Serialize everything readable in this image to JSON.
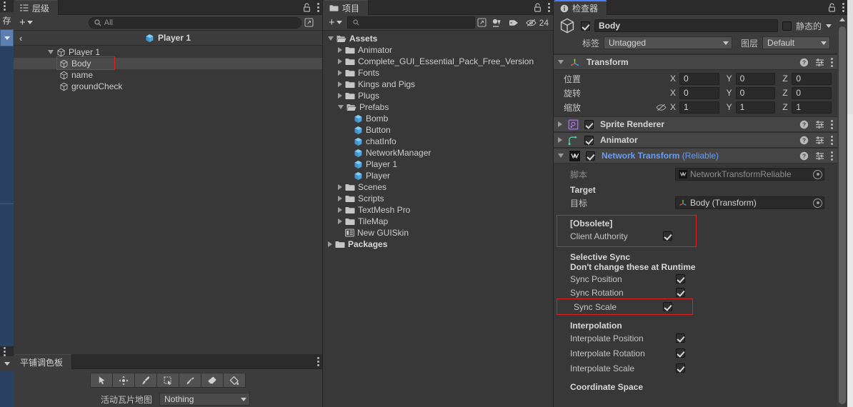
{
  "left_strip": {
    "label": "存",
    "kebab_icon": "kebab-icon",
    "dropdown_icon": "caret-down-icon"
  },
  "hierarchy": {
    "tab_label": "层级",
    "tab_icon": "hierarchy-icon",
    "lock_icon": "lock-icon",
    "menu_icon": "kebab-icon",
    "add_label": "+",
    "add_caret_icon": "caret-down-icon",
    "search": {
      "placeholder": "All",
      "value": "",
      "icon": "search-icon"
    },
    "expand_icon": "open-in-new-icon",
    "breadcrumb": {
      "back_icon": "back-arrow-icon",
      "title": "Player 1",
      "icon": "prefab-icon"
    },
    "tree": [
      {
        "label": "Player 1",
        "depth": 0,
        "expanded": true,
        "icon": "gameobject-icon",
        "selected": false,
        "highlighted": false
      },
      {
        "label": "Body",
        "depth": 1,
        "expanded": null,
        "icon": "gameobject-icon",
        "selected": true,
        "highlighted": true
      },
      {
        "label": "name",
        "depth": 1,
        "expanded": null,
        "icon": "gameobject-icon",
        "selected": false,
        "highlighted": false
      },
      {
        "label": "groundCheck",
        "depth": 1,
        "expanded": null,
        "icon": "gameobject-icon",
        "selected": false,
        "highlighted": false
      }
    ]
  },
  "tile_palette": {
    "tab_label": "平铺调色板",
    "tab_icon": "tilepalette-icon",
    "menu_icon": "kebab-icon",
    "tools": [
      {
        "name": "select-tool",
        "icon": "cursor-arrow-icon"
      },
      {
        "name": "move-tool",
        "icon": "move-icon"
      },
      {
        "name": "paint-tool",
        "icon": "brush-icon"
      },
      {
        "name": "box-fill-tool",
        "icon": "marquee-icon"
      },
      {
        "name": "picker-tool",
        "icon": "eyedropper-icon"
      },
      {
        "name": "erase-tool",
        "icon": "eraser-icon"
      },
      {
        "name": "fill-tool",
        "icon": "paint-bucket-icon"
      }
    ],
    "active_tilemap_label": "活动瓦片地图",
    "active_tilemap_value": "Nothing",
    "dropdown_icon": "caret-down-icon"
  },
  "project": {
    "tab_label": "项目",
    "tab_icon": "folder-icon",
    "lock_icon": "lock-icon",
    "menu_icon": "kebab-icon",
    "add_label": "+",
    "add_caret_icon": "caret-down-icon",
    "search": {
      "placeholder": "",
      "value": "",
      "icon": "search-icon"
    },
    "expand_icon": "open-in-new-icon",
    "filter_type_icon": "filter-by-type-icon",
    "filter_label_icon": "filter-by-label-icon",
    "hidden_count": "24",
    "hidden_icon": "eye-off-icon",
    "tree": [
      {
        "label": "Assets",
        "depth": 0,
        "expanded": true,
        "icon": "folder-open-icon",
        "bold": true
      },
      {
        "label": "Animator",
        "depth": 1,
        "expanded": false,
        "icon": "folder-icon",
        "bold": false
      },
      {
        "label": "Complete_GUI_Essential_Pack_Free_Version",
        "depth": 1,
        "expanded": false,
        "icon": "folder-icon",
        "bold": false
      },
      {
        "label": "Fonts",
        "depth": 1,
        "expanded": false,
        "icon": "folder-icon",
        "bold": false
      },
      {
        "label": "Kings and Pigs",
        "depth": 1,
        "expanded": false,
        "icon": "folder-icon",
        "bold": false
      },
      {
        "label": "Plugs",
        "depth": 1,
        "expanded": false,
        "icon": "folder-icon",
        "bold": false
      },
      {
        "label": "Prefabs",
        "depth": 1,
        "expanded": true,
        "icon": "folder-open-icon",
        "bold": false
      },
      {
        "label": "Bomb",
        "depth": 2,
        "expanded": null,
        "icon": "prefab-icon",
        "bold": false
      },
      {
        "label": "Button",
        "depth": 2,
        "expanded": null,
        "icon": "prefab-icon",
        "bold": false
      },
      {
        "label": "chatInfo",
        "depth": 2,
        "expanded": null,
        "icon": "prefab-icon",
        "bold": false
      },
      {
        "label": "NetworkManager",
        "depth": 2,
        "expanded": null,
        "icon": "prefab-icon",
        "bold": false
      },
      {
        "label": "Player 1",
        "depth": 2,
        "expanded": null,
        "icon": "prefab-icon",
        "bold": false
      },
      {
        "label": "Player",
        "depth": 2,
        "expanded": null,
        "icon": "prefab-icon",
        "bold": false
      },
      {
        "label": "Scenes",
        "depth": 1,
        "expanded": false,
        "icon": "folder-icon",
        "bold": false
      },
      {
        "label": "Scripts",
        "depth": 1,
        "expanded": false,
        "icon": "folder-icon",
        "bold": false
      },
      {
        "label": "TextMesh Pro",
        "depth": 1,
        "expanded": false,
        "icon": "folder-icon",
        "bold": false
      },
      {
        "label": "TileMap",
        "depth": 1,
        "expanded": false,
        "icon": "folder-icon",
        "bold": false
      },
      {
        "label": "New GUISkin",
        "depth": 1,
        "expanded": null,
        "icon": "guiskin-icon",
        "bold": false
      },
      {
        "label": "Packages",
        "depth": 0,
        "expanded": false,
        "icon": "folder-icon",
        "bold": true
      }
    ]
  },
  "inspector": {
    "tab_label": "检查器",
    "tab_icon": "info-icon",
    "lock_icon": "lock-icon",
    "menu_icon": "kebab-icon",
    "object_icon": "gameobject-icon",
    "active_checked": true,
    "name_value": "Body",
    "static_checked": false,
    "static_label": "静态的",
    "static_caret_icon": "caret-down-icon",
    "tag_label": "标签",
    "tag_value": "Untagged",
    "layer_label": "图层",
    "layer_value": "Default",
    "transform": {
      "title": "Transform",
      "icon": "transform-icon",
      "expanded": true,
      "help_icon": "help-icon",
      "preset_icon": "preset-icon",
      "menu_icon": "kebab-icon",
      "rows": [
        {
          "label": "位置",
          "x": "0",
          "y": "0",
          "z": "0",
          "eye_icon": null
        },
        {
          "label": "旋转",
          "x": "0",
          "y": "0",
          "z": "0",
          "eye_icon": null
        },
        {
          "label": "缩放",
          "x": "1",
          "y": "1",
          "z": "1",
          "eye_icon": "eye-off-icon"
        }
      ],
      "axis_labels": [
        "X",
        "Y",
        "Z"
      ]
    },
    "components": [
      {
        "title": "Sprite Renderer",
        "icon": "sprite-renderer-icon",
        "expanded": false,
        "enabled": true,
        "link": false,
        "help_icon": "help-icon",
        "preset_icon": "preset-icon",
        "menu_icon": "kebab-icon"
      },
      {
        "title": "Animator",
        "icon": "animator-icon",
        "expanded": false,
        "enabled": true,
        "link": false,
        "help_icon": "help-icon",
        "preset_icon": "preset-icon",
        "menu_icon": "kebab-icon"
      }
    ],
    "network_transform": {
      "title": "Network Transform",
      "title_suffix": "(Reliable)",
      "icon": "script-icon",
      "expanded": true,
      "enabled": true,
      "help_icon": "help-icon",
      "preset_icon": "preset-icon",
      "menu_icon": "kebab-icon",
      "script_label": "脚本",
      "script_value": "NetworkTransformReliable",
      "script_icon": "script-icon",
      "target_header": "Target",
      "target_label": "目标",
      "target_value": "Body (Transform)",
      "target_icon": "transform-icon",
      "obsolete_header": "[Obsolete]",
      "client_authority_label": "Client Authority",
      "client_authority_checked": true,
      "selective_sync_header": "Selective Sync",
      "selective_sync_subheader": "Don't change these at Runtime",
      "sync_fields": [
        {
          "label": "Sync Position",
          "checked": true,
          "highlighted": false
        },
        {
          "label": "Sync Rotation",
          "checked": true,
          "highlighted": false
        },
        {
          "label": "Sync Scale",
          "checked": true,
          "highlighted": true
        }
      ],
      "interpolation_header": "Interpolation",
      "interpolation_fields": [
        {
          "label": "Interpolate Position",
          "checked": true
        },
        {
          "label": "Interpolate Rotation",
          "checked": true
        },
        {
          "label": "Interpolate Scale",
          "checked": true
        }
      ],
      "coordinate_space_header": "Coordinate Space"
    },
    "scrollbar": {
      "name": "inspector-scrollbar",
      "up_arrow_icon": "caret-up-icon"
    }
  },
  "colors": {
    "panel_bg": "#383838",
    "header_bg": "#3c3c3c",
    "comp_header_bg": "#454545",
    "tabbar_bg": "#2b2b2b",
    "field_bg": "#2a2a2a",
    "accent_blue": "#6a9ef0",
    "highlight_red": "#e02020",
    "selected_row": "#4a4a4a",
    "left_panel_blue": "#2b4162"
  }
}
